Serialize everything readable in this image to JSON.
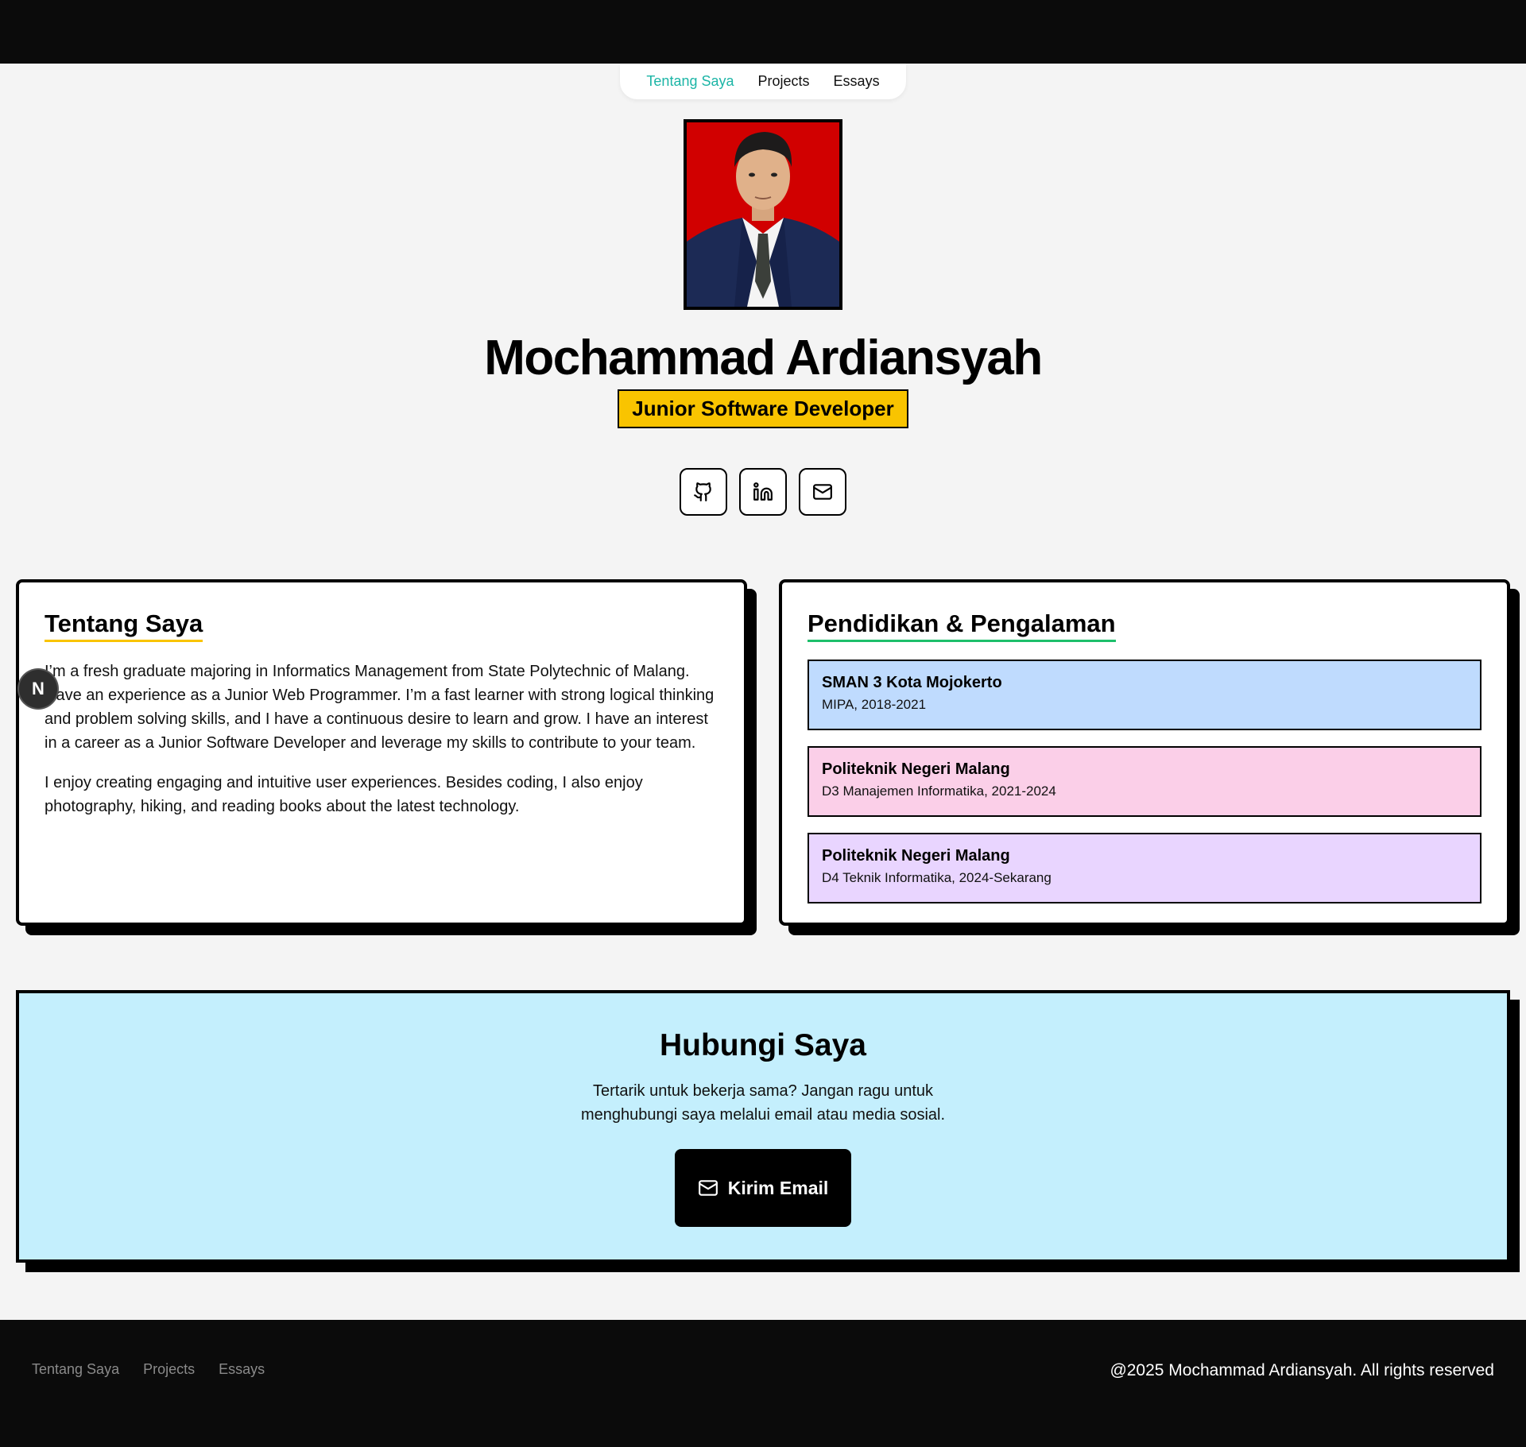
{
  "nav": {
    "items": [
      {
        "label": "Tentang Saya",
        "active": true
      },
      {
        "label": "Projects",
        "active": false
      },
      {
        "label": "Essays",
        "active": false
      }
    ]
  },
  "profile": {
    "name": "Mochammad Ardiansyah",
    "role": "Junior Software Developer"
  },
  "socials": [
    {
      "icon": "github-icon"
    },
    {
      "icon": "linkedin-icon"
    },
    {
      "icon": "mail-icon"
    }
  ],
  "about": {
    "title": "Tentang Saya",
    "paragraphs": [
      "I’m a fresh graduate majoring in Informatics Management from State Polytechnic of Malang. Have an experience as a Junior Web Programmer. I’m a fast learner with strong logical thinking and problem solving skills, and I have a continuous desire to learn and grow. I have an interest in a career as a Junior Software Developer and leverage my skills to contribute to your team.",
      "I enjoy creating engaging and intuitive user experiences. Besides coding, I also enjoy photography, hiking, and reading books about the latest technology."
    ]
  },
  "education": {
    "title": "Pendidikan & Pengalaman",
    "items": [
      {
        "school": "SMAN 3 Kota Mojokerto",
        "detail": "MIPA, 2018-2021",
        "color": "#bfdbfe"
      },
      {
        "school": "Politeknik Negeri Malang",
        "detail": "D3 Manajemen Informatika, 2021-2024",
        "color": "#fbcfe8"
      },
      {
        "school": "Politeknik Negeri Malang",
        "detail": "D4 Teknik Informatika, 2024-Sekarang",
        "color": "#e9d5ff"
      }
    ]
  },
  "contact": {
    "title": "Hubungi Saya",
    "text": "Tertarik untuk bekerja sama? Jangan ragu untuk menghubungi saya melalui email atau media sosial.",
    "button_label": "Kirim Email"
  },
  "dev_badge": {
    "label": "N"
  },
  "footer": {
    "links": [
      "Tentang Saya",
      "Projects",
      "Essays"
    ],
    "copyright": "@2025 Mochammad Ardiansyah. All rights reserved"
  },
  "colors": {
    "accent_teal": "#1cb5a6",
    "role_yellow": "#f9c400",
    "contact_bg": "#c4effd",
    "underline_green": "#1dbf6b"
  }
}
